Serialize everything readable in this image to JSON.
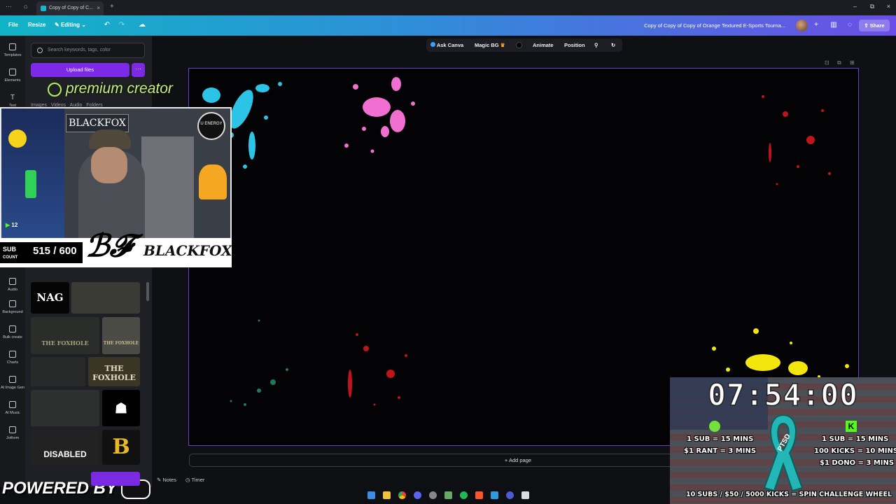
{
  "browser": {
    "tab_title": "Copy of Copy of C...",
    "new_tab_glyph": "+",
    "window_controls": [
      "–",
      "⧉",
      "×"
    ]
  },
  "header": {
    "file": "File",
    "resize": "Resize",
    "editing": "Editing",
    "doc_title": "Copy of Copy of Copy of Orange Textured E-Sports Tourna...",
    "share": "Share"
  },
  "rail": {
    "items": [
      "Templates",
      "Elements",
      "Text",
      "Audio",
      "Background",
      "Bulk create",
      "Charts",
      "AI Image Gen",
      "AI Music",
      "Jotform"
    ]
  },
  "panel": {
    "search_placeholder": "Search keywords, tags, color",
    "upload": "Upload files",
    "more": "···",
    "tabs": [
      "Images",
      "Videos",
      "Audio",
      "Folders"
    ],
    "thumbs": [
      "NAG",
      "THE FOXHOLE",
      "THE FOXHOLE",
      "THE FOXHOLE",
      "DISABLED",
      "B"
    ]
  },
  "overlay_stream": {
    "premium": "premium creator",
    "webcam_name": "BLACKFOX",
    "brand": "BLACKFOX",
    "energy": "U ENERGY",
    "viewer_count": "12",
    "sub_label_top": "SUB",
    "sub_label_bottom": "COUNT",
    "sub_count": "515 / 600",
    "powered": "POWERED BY"
  },
  "canvas_toolbar": {
    "ask": "Ask Canva",
    "magic": "Magic BG",
    "animate": "Animate",
    "position": "Position"
  },
  "canvas": {
    "add_page": "+ Add page",
    "notes": "Notes",
    "timer": "Timer"
  },
  "timer_overlay": {
    "clock": "07:54:00",
    "left_1": "1 SUB = 15 MINS",
    "left_2": "$1 RANT = 3 MINS",
    "right_1": "1 SUB = 15 MINS",
    "right_2": "100 KICKS = 10 MINS",
    "right_3": "$1 DONO = 3 MINS",
    "bottom": "10 SUBS / $50 / 5000 KICKS = SPIN CHALLENGE WHEEL",
    "ribbon": "PTSD"
  },
  "colors": {
    "accent": "#7d2ae8",
    "header_start": "#11b3c6",
    "header_end": "#6b4ee6",
    "splat_cyan": "#2bc3e6",
    "splat_pink": "#f06fd0",
    "splat_red": "#d10f16",
    "splat_yellow": "#f4e60c",
    "splat_green": "#1f7a5a"
  }
}
